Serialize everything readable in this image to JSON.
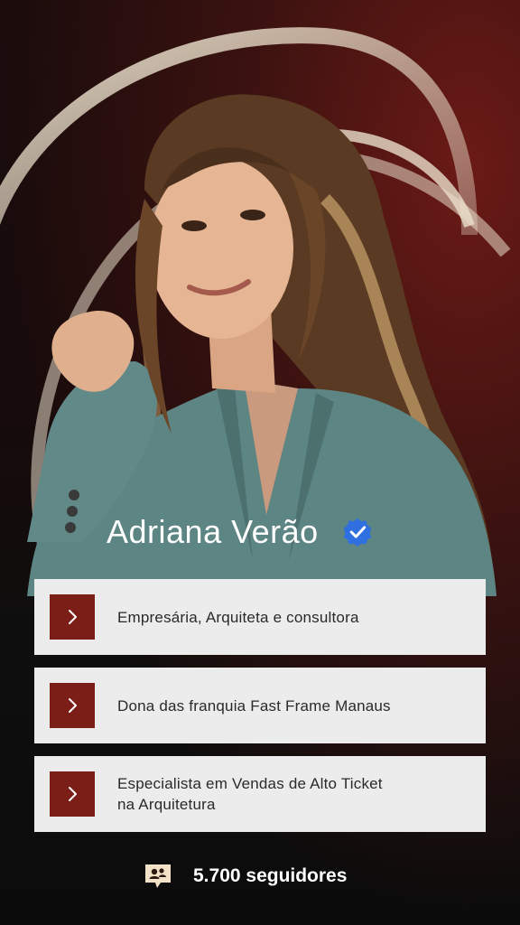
{
  "profile": {
    "name": "Adriana Verão",
    "verified_icon": "verified-badge-icon"
  },
  "items": [
    {
      "text": "Empresária, Arquiteta e consultora",
      "icon": "chevron-right-icon"
    },
    {
      "text": "Dona das franquia Fast Frame Manaus",
      "icon": "chevron-right-icon"
    },
    {
      "text": "Especialista em Vendas de Alto Ticket na Arquitetura",
      "icon": "chevron-right-icon"
    }
  ],
  "followers": {
    "label": "5.700 seguidores",
    "icon": "followers-icon"
  },
  "colors": {
    "accent": "#7a1e17",
    "background_top": "#5a1612",
    "background_bottom": "#0b0b0b",
    "card": "#ececec",
    "verified": "#2f6fe0",
    "arc": "#e9dcc6"
  }
}
